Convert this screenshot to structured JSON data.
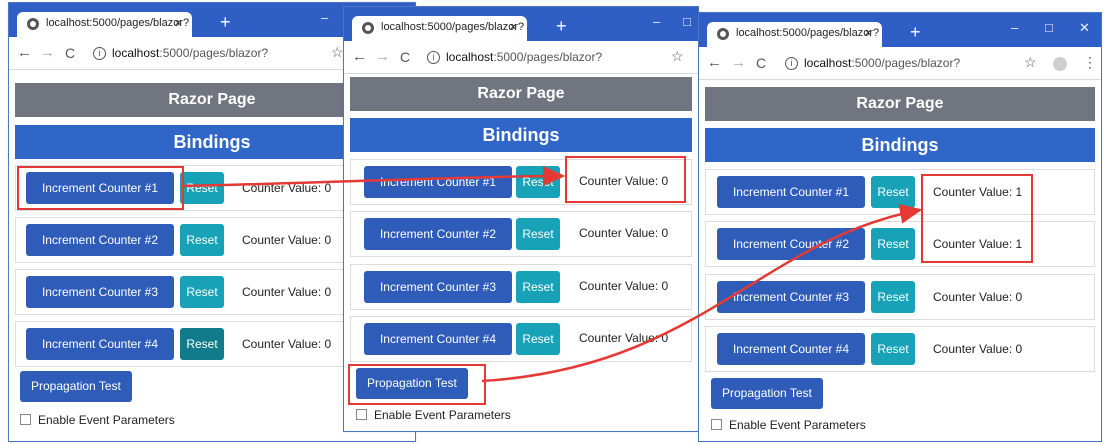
{
  "tab_title": "localhost:5000/pages/blazor?",
  "new_tab": "+",
  "url_host": "localhost",
  "url_rest": ":5000/pages/blazor?",
  "header_razor": "Razor Page",
  "header_bindings": "Bindings",
  "counters": [
    {
      "label": "Increment Counter #1",
      "reset": "Reset"
    },
    {
      "label": "Increment Counter #2",
      "reset": "Reset"
    },
    {
      "label": "Increment Counter #3",
      "reset": "Reset"
    },
    {
      "label": "Increment Counter #4",
      "reset": "Reset"
    }
  ],
  "values_left": [
    "Counter Value: 0",
    "Counter Value: 0",
    "Counter Value: 0",
    "Counter Value: 0"
  ],
  "values_mid": [
    "Counter Value: 0",
    "Counter Value: 0",
    "Counter Value: 0",
    "Counter Value: 0"
  ],
  "values_right": [
    "Counter Value: 1",
    "Counter Value: 1",
    "Counter Value: 0",
    "Counter Value: 0"
  ],
  "propagation_button": "Propagation Test",
  "checkbox_label": "Enable Event Parameters",
  "colors": {
    "chrome": "#2f5fc4",
    "primary": "#2e5cb8",
    "reset": "#17a2b8",
    "highlight": "#e53935",
    "razor_header": "#707580"
  }
}
